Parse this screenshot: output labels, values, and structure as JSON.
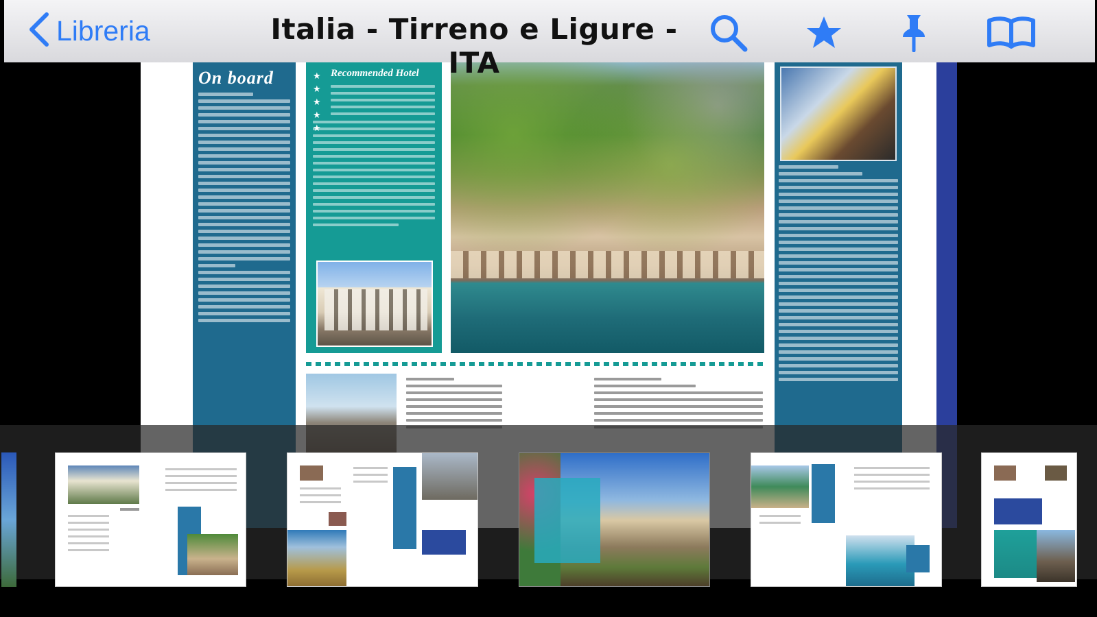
{
  "navbar": {
    "back_label": "Libreria",
    "title": "Italia - Tirreno e Ligure - ITA",
    "accent_color": "#2f7cf6",
    "icons": [
      "chevron-left-icon",
      "search-icon",
      "star-icon",
      "pin-icon",
      "book-icon"
    ]
  },
  "page": {
    "onboard_title": "On board",
    "recommended_title": "Recommended Hotel"
  },
  "thumbnails": {
    "count": 6,
    "selected_index": 3
  }
}
